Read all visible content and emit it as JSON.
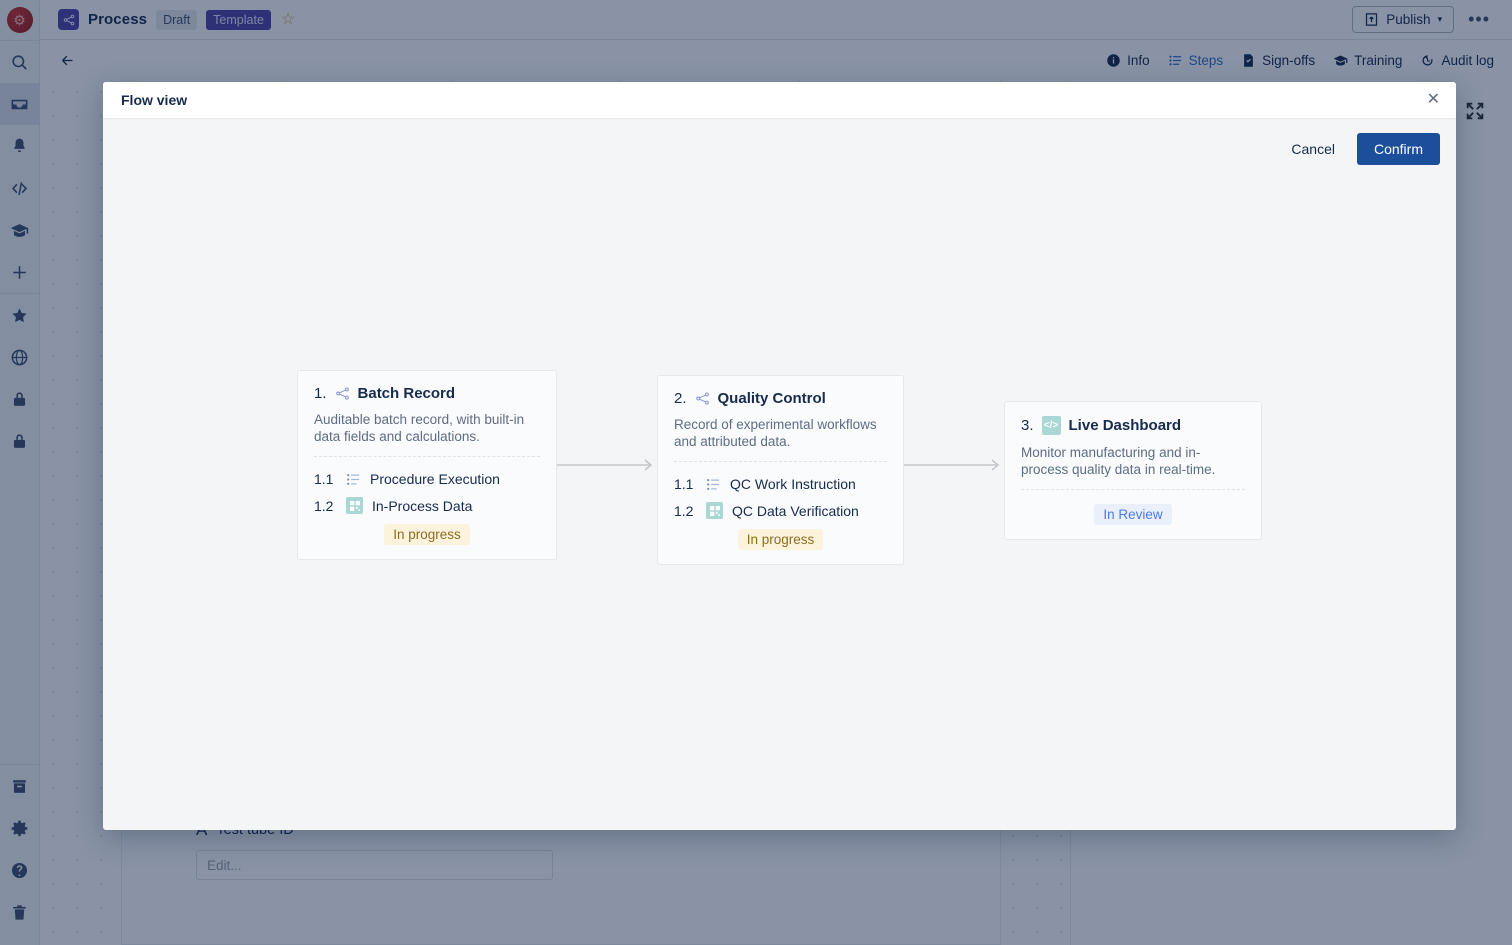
{
  "app": {
    "logo_icon": "lab-logo-icon",
    "rail_items": [
      {
        "name": "search-icon",
        "label": "Search"
      },
      {
        "name": "inbox-icon",
        "label": "Inbox"
      },
      {
        "name": "bell-icon",
        "label": "Notifications"
      },
      {
        "name": "code-icon",
        "label": "Code"
      },
      {
        "name": "graduation-cap-icon",
        "label": "Training"
      },
      {
        "name": "plus-icon",
        "label": "Create"
      },
      {
        "name": "star-icon",
        "label": "Favorites"
      },
      {
        "name": "globe-icon",
        "label": "Global"
      },
      {
        "name": "lock-icon",
        "label": "Private"
      },
      {
        "name": "lock-icon-2",
        "label": "Locked"
      },
      {
        "name": "archive-icon",
        "label": "Archive"
      },
      {
        "name": "gear-icon",
        "label": "Settings"
      },
      {
        "name": "help-icon",
        "label": "Help"
      },
      {
        "name": "trash-icon",
        "label": "Trash"
      }
    ]
  },
  "topbar": {
    "doc_icon": "flow-doc-icon",
    "title": "Process",
    "status_chip": "Draft",
    "template_chip": "Template",
    "star_glyph": "☆",
    "publish_label": "Publish",
    "publish_caret": "▾",
    "more_label": "•••"
  },
  "subbar": {
    "back_icon": "back-arrow-icon",
    "tabs": [
      {
        "label": "Info",
        "icon": "info-icon",
        "active": false
      },
      {
        "label": "Steps",
        "icon": "list-icon",
        "active": true
      },
      {
        "label": "Sign-offs",
        "icon": "signoff-doc-icon",
        "active": false
      },
      {
        "label": "Training",
        "icon": "graduation-cap-icon",
        "active": false
      },
      {
        "label": "Audit log",
        "icon": "history-clock-icon",
        "active": false
      }
    ]
  },
  "background_form": {
    "field_glyph": "A",
    "field_label": "Test tube ID",
    "field_placeholder": "Edit..."
  },
  "expand_icon": "expand-fullscreen-icon",
  "modal": {
    "title": "Flow view",
    "close_glyph": "✕",
    "cancel_label": "Cancel",
    "confirm_label": "Confirm"
  },
  "flow": {
    "arrow_icon": "right-arrow-icon",
    "cards": [
      {
        "number": "1.",
        "icon": "flow-node-icon",
        "title": "Batch Record",
        "description": "Auditable batch record, with built-in data fields and calculations.",
        "steps": [
          {
            "number": "1.1",
            "icon": "list-steps-icon",
            "name": "Procedure Execution"
          },
          {
            "number": "1.2",
            "icon": "grid-data-icon",
            "name": "In-Process Data"
          }
        ],
        "badge": "In progress",
        "badge_style": "inprogress"
      },
      {
        "number": "2.",
        "icon": "flow-node-icon",
        "title": "Quality Control",
        "description": "Record of experimental workflows and attributed data.",
        "steps": [
          {
            "number": "1.1",
            "icon": "list-steps-icon",
            "name": "QC Work Instruction"
          },
          {
            "number": "1.2",
            "icon": "grid-data-icon",
            "name": "QC Data Verification"
          }
        ],
        "badge": "In progress",
        "badge_style": "inprogress"
      },
      {
        "number": "3.",
        "icon": "code-dashboard-icon",
        "title": "Live Dashboard",
        "description": "Monitor manufacturing and in-process quality data in real-time.",
        "steps": [],
        "badge": "In Review",
        "badge_style": "inreview"
      }
    ]
  },
  "colors": {
    "accent_blue": "#1b4f9c",
    "template_purple": "#5243aa",
    "badge_progress_bg": "#fdf3dd",
    "badge_progress_fg": "#8a6d1f",
    "badge_review_bg": "#eaeffc",
    "badge_review_fg": "#4b7ce8",
    "icon_teal": "#a9d8d4",
    "icon_periwinkle": "#8e9bd1"
  }
}
